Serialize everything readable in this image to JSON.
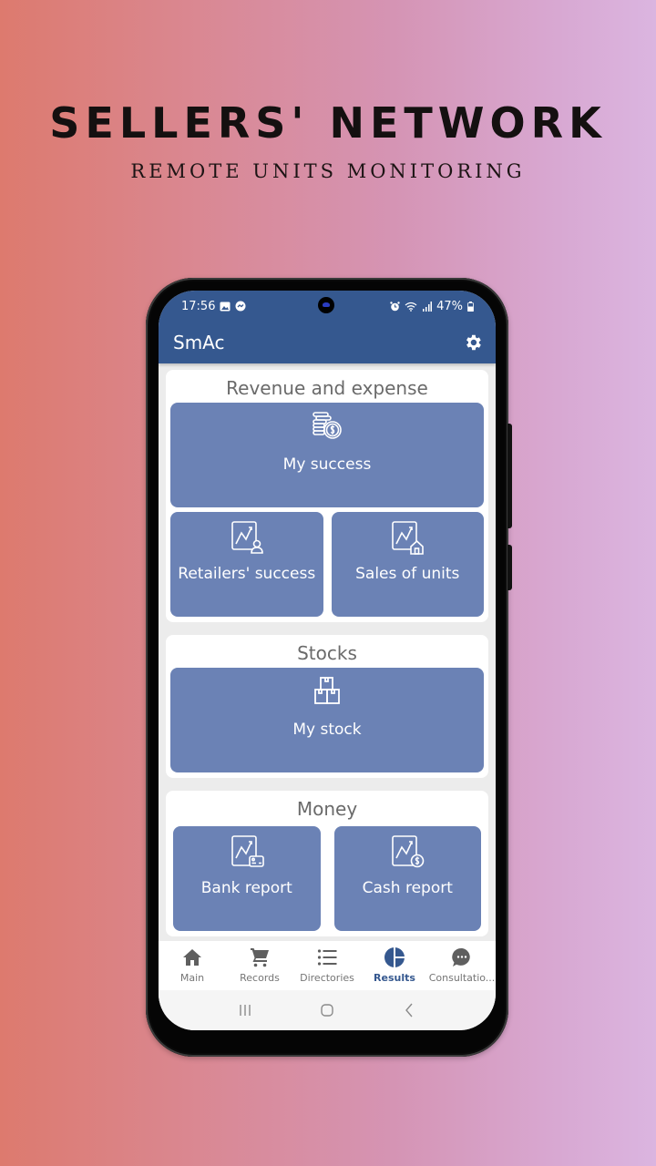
{
  "promo": {
    "title": "SELLERS' NETWORK",
    "subtitle": "REMOTE UNITS MONITORING"
  },
  "status_bar": {
    "time": "17:56",
    "left_icons": [
      "gallery-icon",
      "messenger-icon"
    ],
    "right_icons": [
      "alarm-icon",
      "wifi-icon",
      "signal-icon"
    ],
    "battery": "47%"
  },
  "app_bar": {
    "title": "SmAc",
    "settings_icon": "gear-icon"
  },
  "sections": [
    {
      "title": "Revenue and expense",
      "tiles": [
        {
          "label": "My success",
          "icon": "coins-dollar-icon"
        },
        {
          "label": "Retailers' success",
          "icon": "chart-person-icon"
        },
        {
          "label": "Sales of units",
          "icon": "chart-house-icon"
        }
      ]
    },
    {
      "title": "Stocks",
      "tiles": [
        {
          "label": "My stock",
          "icon": "boxes-icon"
        }
      ]
    },
    {
      "title": "Money",
      "tiles": [
        {
          "label": "Bank report",
          "icon": "chart-card-icon"
        },
        {
          "label": "Cash report",
          "icon": "chart-dollar-icon"
        }
      ]
    }
  ],
  "bottom_nav": {
    "items": [
      {
        "label": "Main",
        "icon": "home-icon"
      },
      {
        "label": "Records",
        "icon": "cart-icon"
      },
      {
        "label": "Directories",
        "icon": "list-icon"
      },
      {
        "label": "Results",
        "icon": "pie-chart-icon",
        "active": true
      },
      {
        "label": "Consultatio...",
        "icon": "chat-icon"
      }
    ]
  },
  "colors": {
    "primary": "#35588f",
    "tile": "#6b82b5",
    "active_nav": "#35588f"
  }
}
